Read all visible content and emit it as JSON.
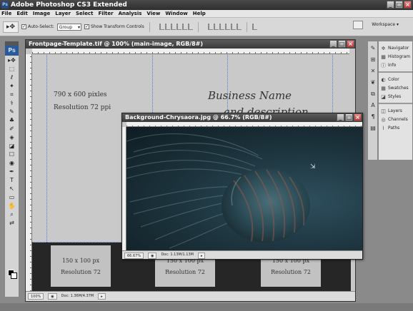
{
  "app": {
    "title": "Adobe Photoshop CS3 Extended",
    "logo": "Ps"
  },
  "menu": [
    "File",
    "Edit",
    "Image",
    "Layer",
    "Select",
    "Filter",
    "Analysis",
    "View",
    "Window",
    "Help"
  ],
  "options_bar": {
    "auto_select_label": "Auto-Select:",
    "auto_select_value": "Group",
    "show_transform_label": "Show Transform Controls",
    "workspace_label": "Workspace ▾"
  },
  "panels": {
    "group1": [
      "Navigator",
      "Histogram",
      "Info"
    ],
    "group2": [
      "Color",
      "Swatches",
      "Styles"
    ],
    "group3": [
      "Layers",
      "Channels",
      "Paths"
    ]
  },
  "main_doc": {
    "title": "Frontpage-Template.tif @ 100% (main-image, RGB/8#)",
    "size_line1": "790 x 600 pixles",
    "size_line2": "Resolution 72 ppi",
    "business_line1": "Business Name",
    "business_line2": "and description...",
    "thumbs": [
      {
        "line1": "150 x 100 px",
        "line2": "Resolution 72"
      },
      {
        "line1": "150 x 100 px",
        "line2": "Resolution 72"
      },
      {
        "line1": "150 x 100 px",
        "line2": "Resolution 72"
      }
    ],
    "zoom": "100%",
    "doc_info": "Doc: 1.36M/4.37M"
  },
  "jelly_doc": {
    "title": "Background-Chrysaora.jpg @ 66.7% (RGB/8#)",
    "zoom": "66.67%",
    "doc_info": "Doc: 1.13M/1.13M"
  },
  "tools": [
    "▸✥",
    "⬚",
    "ℓ",
    "✦",
    "⌗",
    "⚕",
    "✎",
    "♣",
    "✐",
    "◈",
    "◪",
    "☐",
    "◉",
    "✒",
    "T",
    "↖",
    "▭",
    "✋",
    "⌕",
    "⇄"
  ]
}
